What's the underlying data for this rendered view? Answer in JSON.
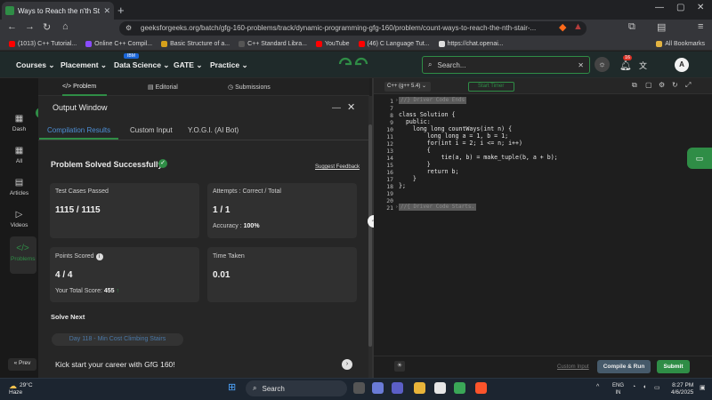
{
  "browser": {
    "tab_title": "Ways to Reach the n'th Stair | P",
    "url": "geeksforgeeks.org/batch/gfg-160-problems/track/dynamic-programming-gfg-160/problem/count-ways-to-reach-the-nth-stair-...",
    "bookmarks": [
      {
        "label": "(1013) C++ Tutorial...",
        "color": "#ff0000"
      },
      {
        "label": "Online C++ Compil...",
        "color": "#8a4cff"
      },
      {
        "label": "Basic Structure of a...",
        "color": "#d6a01b"
      },
      {
        "label": "C++ Standard Libra...",
        "color": "#555555"
      },
      {
        "label": "YouTube",
        "color": "#ff0000"
      },
      {
        "label": "(46) C Language Tut...",
        "color": "#ff0000"
      },
      {
        "label": "https://chat.openai...",
        "color": "#dddddd"
      }
    ],
    "all_bookmarks": "All Bookmarks"
  },
  "gfg_nav": {
    "items": [
      "Courses",
      "Placement",
      "Data Science",
      "GATE",
      "Practice"
    ],
    "ibm_badge": "IBM",
    "logo": "GfG",
    "search_placeholder": "Search...",
    "notification_count": "16",
    "avatar": "A"
  },
  "rail": {
    "items": [
      "Dash",
      "All",
      "Articles",
      "Videos",
      "Problems"
    ],
    "prev": "Prev"
  },
  "problem_tabs": [
    "Problem",
    "Editorial",
    "Submissions"
  ],
  "output": {
    "title": "Output Window",
    "tabs": [
      "Compilation Results",
      "Custom Input",
      "Y.O.G.I. (AI Bot)"
    ],
    "status": "Problem Solved Successfully",
    "feedback": "Suggest Feedback",
    "test_cases_label": "Test Cases Passed",
    "test_cases_value": "1115 / 1115",
    "attempts_label": "Attempts : Correct / Total",
    "attempts_value": "1 / 1",
    "accuracy_label": "Accuracy :",
    "accuracy_value": "100%",
    "points_label": "Points Scored",
    "points_value": "4 / 4",
    "total_score_label": "Your Total Score:",
    "total_score_value": "455",
    "time_label": "Time Taken",
    "time_value": "0.01",
    "solve_next": "Solve Next",
    "next_problem": "Day 118 - Min Cost Climbing Stairs",
    "kickstart": "Kick start your career with GfG 160!"
  },
  "editor": {
    "language": "C++ (g++ 5.4)",
    "start_timer": "Start Timer",
    "collapsed_top": "//} Driver Code Ends",
    "collapsed_bottom": "//{ Driver Code Starts.",
    "lines": [
      {
        "n": "1",
        "text": ""
      },
      {
        "n": "7",
        "text": ""
      },
      {
        "n": "8",
        "text": "class Solution {"
      },
      {
        "n": "9",
        "text": "  public:"
      },
      {
        "n": "10",
        "text": "    long long countWays(int n) {"
      },
      {
        "n": "11",
        "text": "        long long a = 1, b = 1;"
      },
      {
        "n": "12",
        "text": "        for(int i = 2; i <= n; i++)"
      },
      {
        "n": "13",
        "text": "        {"
      },
      {
        "n": "14",
        "text": "            tie(a, b) = make_tuple(b, a + b);"
      },
      {
        "n": "15",
        "text": "        }"
      },
      {
        "n": "16",
        "text": "        return b;"
      },
      {
        "n": "17",
        "text": "    }"
      },
      {
        "n": "18",
        "text": "};"
      },
      {
        "n": "19",
        "text": ""
      },
      {
        "n": "20",
        "text": ""
      },
      {
        "n": "21",
        "text": ""
      }
    ],
    "custom_input": "Custom Input",
    "compile_run": "Compile & Run",
    "submit": "Submit"
  },
  "taskbar": {
    "temp": "29°C",
    "weather": "Haze",
    "search": "Search",
    "lang1": "ENG",
    "lang2": "IN",
    "time": "8:27 PM",
    "date": "4/6/2025"
  },
  "colors": {
    "brand_green": "#2f8d46",
    "editor_bg": "#1e1e1e",
    "panel_bg": "#262626"
  }
}
